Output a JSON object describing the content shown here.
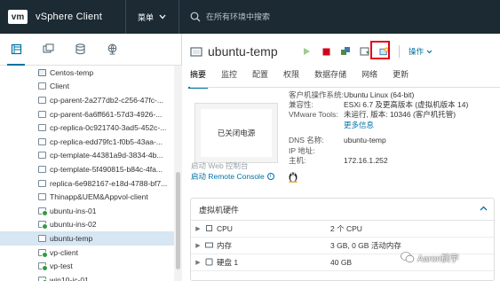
{
  "header": {
    "logo": "vm",
    "app_title": "vSphere Client",
    "menu_label": "菜单",
    "search_placeholder": "在所有环境中搜索"
  },
  "navigator": {
    "tabs": [
      "hosts-clusters-icon",
      "vms-templates-icon",
      "storage-icon",
      "networking-icon"
    ],
    "items": [
      {
        "label": "Centos-temp",
        "type": "template"
      },
      {
        "label": "Client",
        "type": "vm"
      },
      {
        "label": "cp-parent-2a277db2-c256-47fc-...",
        "type": "vm"
      },
      {
        "label": "cp-parent-6a6ff661-57d3-4926-...",
        "type": "vm"
      },
      {
        "label": "cp-replica-0c921740-3ad5-452c-...",
        "type": "vm"
      },
      {
        "label": "cp-replica-edd79fc1-f0b5-43aa-...",
        "type": "vm"
      },
      {
        "label": "cp-template-44381a9d-3834-4b...",
        "type": "vm"
      },
      {
        "label": "cp-template-5f490815-b84c-4fa...",
        "type": "vm"
      },
      {
        "label": "replica-6e982167-e18d-4788-bf7...",
        "type": "vm"
      },
      {
        "label": "Thinapp&UEM&Appvol-client",
        "type": "vm"
      },
      {
        "label": "ubuntu-ins-01",
        "type": "vm-on"
      },
      {
        "label": "ubuntu-ins-02",
        "type": "vm-on"
      },
      {
        "label": "ubuntu-temp",
        "type": "vm",
        "selected": true
      },
      {
        "label": "vp-client",
        "type": "vm-on"
      },
      {
        "label": "vp-test",
        "type": "vm-on"
      },
      {
        "label": "win10-ic-01",
        "type": "vm-on"
      }
    ]
  },
  "vm": {
    "name": "ubuntu-temp",
    "actions_label": "操作",
    "tabs": [
      "摘要",
      "监控",
      "配置",
      "权限",
      "数据存储",
      "网络",
      "更新"
    ],
    "console_text": "已关闭电源",
    "web_console": "启动 Web 控制台",
    "remote_console": "启动 Remote Console",
    "props": [
      {
        "key": "客户机操作系统:",
        "value": "Ubuntu Linux (64-bit)"
      },
      {
        "key": "兼容性:",
        "value": "ESXi 6.7 及更高版本 (虚拟机版本 14)"
      },
      {
        "key": "VMware Tools:",
        "value": "未运行, 版本: 10346 (客户机托管)"
      },
      {
        "key": "",
        "value": "更多信息",
        "link": true
      },
      {
        "key": "DNS 名称:",
        "value": "ubuntu-temp",
        "gap": true
      },
      {
        "key": "IP 地址:",
        "value": ""
      },
      {
        "key": "主机:",
        "value": "172.16.1.252"
      }
    ]
  },
  "hardware": {
    "title": "虚拟机硬件",
    "rows": [
      {
        "name": "CPU",
        "value": "2 个 CPU",
        "icon": "cpu-icon"
      },
      {
        "name": "内存",
        "value": "3 GB, 0 GB 活动内存",
        "icon": "memory-icon"
      },
      {
        "name": "硬盘 1",
        "value": "40 GB",
        "icon": "disk-icon"
      }
    ]
  },
  "watermark": "Aaron枫宇",
  "colors": {
    "topbar": "#1b2a33",
    "accent": "#0072a3",
    "highlight": "#e60012",
    "power_on": "#2e9b3f",
    "power_off": "#d0021b"
  }
}
